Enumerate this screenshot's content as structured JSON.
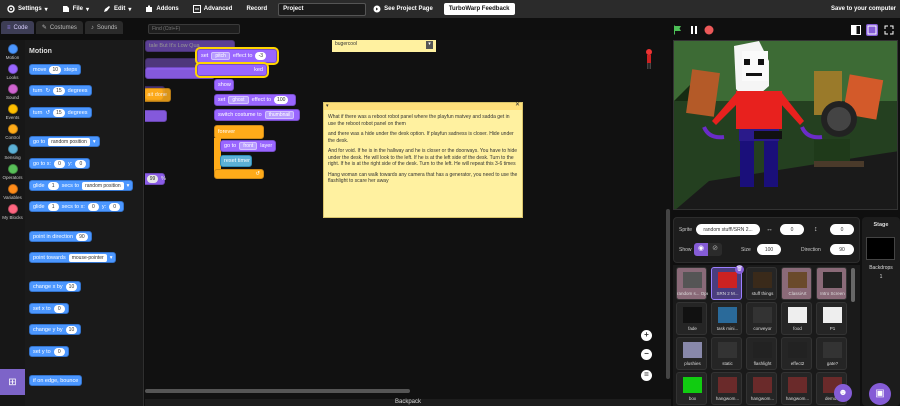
{
  "menubar": {
    "settings": "Settings",
    "file": "File",
    "edit": "Edit",
    "addons": "Addons",
    "advanced": "Advanced",
    "record": "Record",
    "project_title": "Project",
    "see_project_page": "See Project Page",
    "feedback": "TurboWarp Feedback",
    "save": "Save to your computer"
  },
  "tabs": [
    "Code",
    "Costumes",
    "Sounds"
  ],
  "find_placeholder": "Find (Ctrl+F)",
  "categories": [
    {
      "label": "Motion",
      "color": "#4c97ff"
    },
    {
      "label": "Looks",
      "color": "#9966ff"
    },
    {
      "label": "Sound",
      "color": "#cf63cf"
    },
    {
      "label": "Events",
      "color": "#ffbf00"
    },
    {
      "label": "Control",
      "color": "#ffab19"
    },
    {
      "label": "Sensing",
      "color": "#5cb1d6"
    },
    {
      "label": "Operators",
      "color": "#59c059"
    },
    {
      "label": "Variables",
      "color": "#ff8c1a"
    },
    {
      "label": "My Blocks",
      "color": "#ff6680"
    }
  ],
  "palette": {
    "title": "Motion",
    "move": {
      "a": "move",
      "n": "10",
      "b": "steps"
    },
    "turn_cw": {
      "a": "turn",
      "n": "15",
      "b": "degrees"
    },
    "turn_ccw": {
      "a": "turn",
      "n": "15",
      "b": "degrees"
    },
    "goto": {
      "a": "go to",
      "d": "random position"
    },
    "gotoxy": {
      "a": "go to x:",
      "x": "0",
      "b": "y:",
      "y": "0"
    },
    "glide_to": {
      "a": "glide",
      "n": "1",
      "b": "secs to",
      "d": "random position"
    },
    "glide_xy": {
      "a": "glide",
      "n": "1",
      "b": "secs to x:",
      "x": "0",
      "c": "y:",
      "y": "0"
    },
    "point_dir": {
      "a": "point in direction",
      "n": "90"
    },
    "point_towards": {
      "a": "point towards",
      "d": "mouse-pointer"
    },
    "change_x": {
      "a": "change x by",
      "n": "10"
    },
    "set_x": {
      "a": "set x to",
      "n": "0"
    },
    "change_y": {
      "a": "change y by",
      "n": "10"
    },
    "set_y": {
      "a": "set y to",
      "n": "0"
    },
    "bounce": "if on edge, bounce"
  },
  "code": {
    "set_pitch": {
      "a": "set",
      "d": "pitch",
      "b": "effect to",
      "n": "-3"
    },
    "bg_text_1": "tale But It's Low Qua",
    "bg_text_2": "ked",
    "bg_text_3": "ait done",
    "bg_text_4": "99",
    "bg_text_5": "%",
    "show": "show",
    "set_ghost": {
      "a": "set",
      "d": "ghost",
      "b": "effect to",
      "n": "100"
    },
    "switch_costume": {
      "a": "switch costume to",
      "d": "thumbnail"
    },
    "forever": "forever",
    "goto_front": {
      "a": "go to",
      "d": "front",
      "b": "layer"
    },
    "reset_timer": "reset timer",
    "note_small_1": "bugercool",
    "note_big_lines": [
      "What if there was a reboot robot panel where the playfun matvey and sadda get in use the reboot robot panel on them",
      "and there was a hide under the desk option. If playfun sadness is closer. Hide under the desk.",
      "And for void. If he is in the hallway and he is closer or the doorways. You have to hide under the desk. He will look to the left. If he is at the left side of the desk. Turn to the right. If he is at the right side of the desk. Turn to the left. He will repeat this 3-6 times",
      "Hang woman can walk towards any camera that has a generator, you need to use the flashlight to scare her away"
    ],
    "backpack": "Backpack"
  },
  "sprite_info": {
    "sprite_label": "Sprite",
    "sprite_name": "random stuff!/SRN 2...",
    "x": "0",
    "y": "0",
    "show_label": "Show",
    "size_label": "Size",
    "size": "100",
    "direction_label": "Direction",
    "direction": "90"
  },
  "sprites": [
    "random s... Opener",
    "SRN 2 M...",
    "stuff things",
    "ClassiArt",
    "Intro Screen",
    "fade",
    "task mini...",
    "conveyor",
    "food",
    "P1",
    "plushies",
    "static",
    "flashlight",
    "effect2",
    "gate?",
    "box",
    "hangwom...",
    "hangwom...",
    "hangwom...",
    "demo..."
  ],
  "stage_panel": {
    "title": "Stage",
    "backdrops_label": "Backdrops",
    "backdrops_count": "1"
  },
  "colors": {
    "accent": "#855cd6",
    "motion": "#4c97ff",
    "looks": "#9966ff",
    "control": "#ffab19",
    "note": "#fff1a0"
  }
}
